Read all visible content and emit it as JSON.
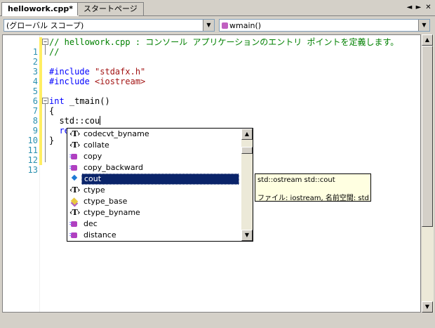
{
  "tabs": [
    {
      "label": "hellowork.cpp*",
      "active": true
    },
    {
      "label": "スタートページ",
      "active": false
    }
  ],
  "tab_controls": {
    "prev": "◄",
    "next": "►",
    "close": "✕"
  },
  "navbar": {
    "scope_combo": "(グローバル スコープ)",
    "member_combo": "wmain()"
  },
  "editor": {
    "lines": [
      {
        "n": "1",
        "text": "// hellowork.cpp : コンソール アプリケーションのエントリ ポイントを定義します。"
      },
      {
        "n": "2",
        "text": "//"
      },
      {
        "n": "3",
        "text": ""
      },
      {
        "n": "4",
        "text": "#include \"stdafx.h\""
      },
      {
        "n": "5",
        "text": "#include <iostream>"
      },
      {
        "n": "6",
        "text": ""
      },
      {
        "n": "7",
        "text": "int _tmain()"
      },
      {
        "n": "8",
        "text": "{"
      },
      {
        "n": "9",
        "text": "  std::cou"
      },
      {
        "n": "10",
        "text": "  re"
      },
      {
        "n": "11",
        "text": "}"
      },
      {
        "n": "12",
        "text": ""
      },
      {
        "n": "13",
        "text": ""
      }
    ],
    "code_parts": {
      "l1": "// hellowork.cpp : コンソール アプリケーションのエントリ ポイントを定義します。",
      "l2": "//",
      "l4_kw": "#include",
      "l4_str": " \"stdafx.h\"",
      "l5_kw": "#include",
      "l5_str": " <iostream>",
      "l7_kw": "int",
      "l7_rest": " _tmain()",
      "l8": "{",
      "l9": "  std::cou",
      "l10": "  re",
      "l11": "}"
    }
  },
  "autocomplete": {
    "items": [
      {
        "label": "codecvt_byname",
        "icon": "type-icon"
      },
      {
        "label": "collate",
        "icon": "type-icon"
      },
      {
        "label": "copy",
        "icon": "function-icon"
      },
      {
        "label": "copy_backward",
        "icon": "function-icon"
      },
      {
        "label": "cout",
        "icon": "variable-icon",
        "selected": true
      },
      {
        "label": "ctype",
        "icon": "type-icon"
      },
      {
        "label": "ctype_base",
        "icon": "template-icon"
      },
      {
        "label": "ctype_byname",
        "icon": "type-icon"
      },
      {
        "label": "dec",
        "icon": "function-icon"
      },
      {
        "label": "distance",
        "icon": "function-icon"
      }
    ],
    "type_glyph": "‹T›"
  },
  "tooltip": {
    "signature": "std::ostream std::cout",
    "info": "ファイル: iostream, 名前空間: std"
  },
  "colors": {
    "comment": "#008000",
    "keyword": "#0000ff",
    "string": "#a31515",
    "line_number": "#2b91af",
    "selection": "#0a246a"
  }
}
